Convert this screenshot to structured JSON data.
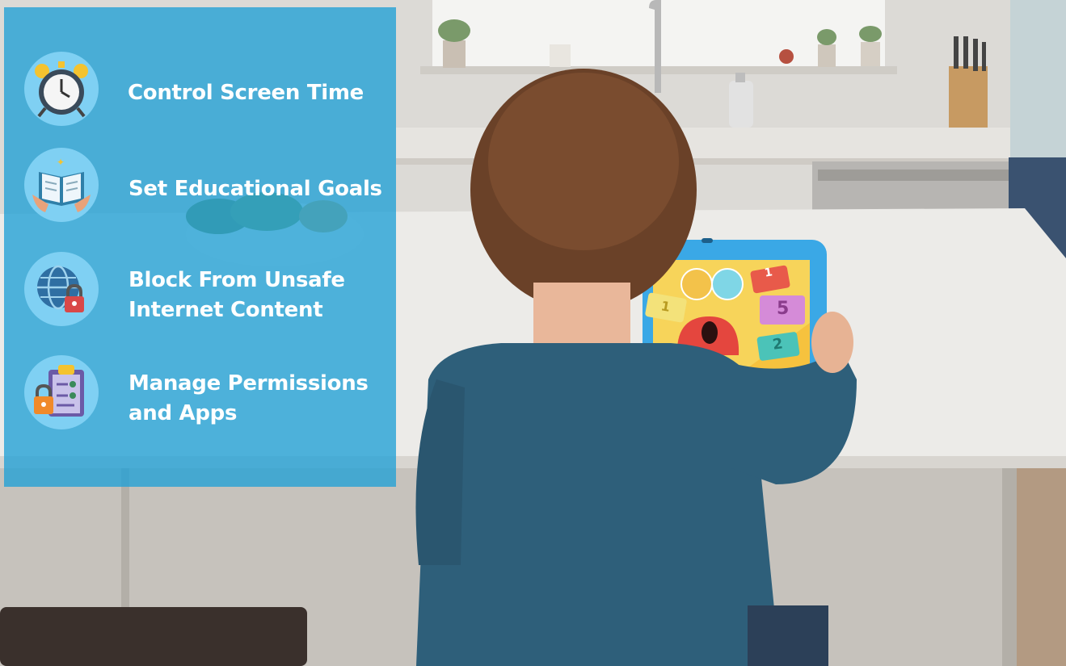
{
  "features": [
    {
      "label": "Control Screen Time",
      "icon": "alarm-clock-icon"
    },
    {
      "label": "Set Educational Goals",
      "icon": "open-book-icon"
    },
    {
      "label": "Block From Unsafe Internet Content",
      "line1": "Block From Unsafe",
      "line2": "Internet Content",
      "icon": "globe-lock-icon"
    },
    {
      "label": "Manage Permissions and Apps",
      "line1": "Manage Permissions",
      "line2": "and Apps",
      "icon": "clipboard-lock-icon"
    }
  ],
  "tablet_screen_numbers": [
    "1",
    "5",
    "2",
    "1"
  ],
  "colors": {
    "panel": "#20a0d6",
    "icon_badge": "#7fd0f3",
    "shirt": "#2e5f7a",
    "tablet_case": "#3aa8e6"
  }
}
